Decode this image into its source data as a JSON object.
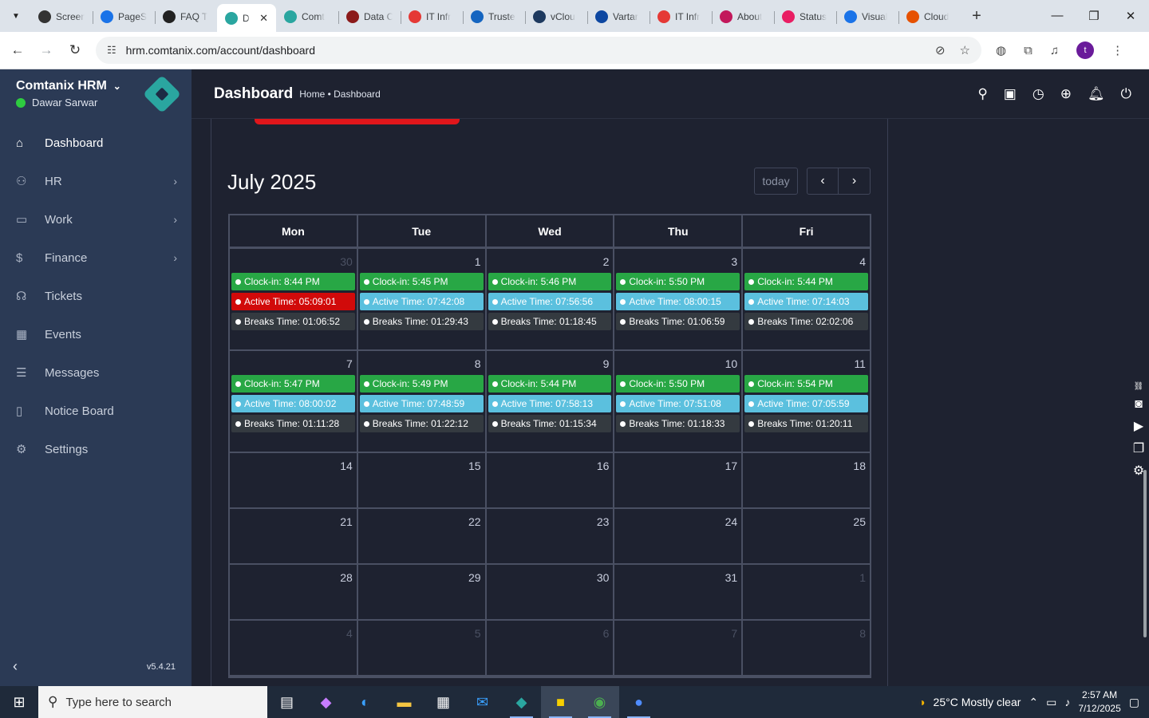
{
  "browser": {
    "tabs": [
      {
        "title": "Screen",
        "icon": "screen-icon",
        "color": "#333333"
      },
      {
        "title": "PageSpeed",
        "icon": "pagespeed-icon",
        "color": "#1a73e8"
      },
      {
        "title": "FAQ T",
        "icon": "faq-icon",
        "color": "#222222"
      },
      {
        "title": "D",
        "icon": "comtanix-icon",
        "color": "#2aa6a0",
        "active": true
      },
      {
        "title": "Comt",
        "icon": "comtanix-icon",
        "color": "#2aa6a0"
      },
      {
        "title": "Data C",
        "icon": "vmware-icon",
        "color": "#8b1a1a"
      },
      {
        "title": "IT Infr",
        "icon": "itinfra-icon",
        "color": "#e53935"
      },
      {
        "title": "Truste",
        "icon": "trust-icon",
        "color": "#1565c0"
      },
      {
        "title": "vClou",
        "icon": "vcloud-icon",
        "color": "#1e3a5f"
      },
      {
        "title": "Vartar",
        "icon": "vartar-icon",
        "color": "#0d47a1"
      },
      {
        "title": "IT Infr",
        "icon": "itinfra-icon",
        "color": "#e53935"
      },
      {
        "title": "About",
        "icon": "about-icon",
        "color": "#c2185b"
      },
      {
        "title": "Status",
        "icon": "status-icon",
        "color": "#e91e63"
      },
      {
        "title": "Visual",
        "icon": "visual-icon",
        "color": "#1a73e8"
      },
      {
        "title": "Cloud",
        "icon": "cloud-icon",
        "color": "#e65100"
      }
    ],
    "url": "hrm.comtanix.com/account/dashboard"
  },
  "sidebar": {
    "brand": "Comtanix HRM",
    "user": "Dawar Sarwar",
    "items": [
      {
        "label": "Dashboard",
        "icon": "home-icon",
        "glyph": "⌂",
        "active": true,
        "arrow": false
      },
      {
        "label": "HR",
        "icon": "users-icon",
        "glyph": "⚇",
        "active": false,
        "arrow": true
      },
      {
        "label": "Work",
        "icon": "briefcase-icon",
        "glyph": "▭",
        "active": false,
        "arrow": true
      },
      {
        "label": "Finance",
        "icon": "dollar-icon",
        "glyph": "$",
        "active": false,
        "arrow": true
      },
      {
        "label": "Tickets",
        "icon": "headset-icon",
        "glyph": "☊",
        "active": false,
        "arrow": false
      },
      {
        "label": "Events",
        "icon": "calendar-icon",
        "glyph": "▦",
        "active": false,
        "arrow": false
      },
      {
        "label": "Messages",
        "icon": "message-icon",
        "glyph": "☰",
        "active": false,
        "arrow": false
      },
      {
        "label": "Notice Board",
        "icon": "clipboard-icon",
        "glyph": "▯",
        "active": false,
        "arrow": false
      },
      {
        "label": "Settings",
        "icon": "gear-icon",
        "glyph": "⚙",
        "active": false,
        "arrow": false
      }
    ],
    "version": "v5.4.21"
  },
  "header": {
    "title": "Dashboard",
    "breadcrumb": "Home • Dashboard"
  },
  "calendar": {
    "title": "July 2025",
    "today_label": "today",
    "days": [
      "Mon",
      "Tue",
      "Wed",
      "Thu",
      "Fri"
    ],
    "weeks": [
      [
        {
          "day": "30",
          "muted": true,
          "events": [
            {
              "type": "clock",
              "text": "Clock-in: 8:44 PM"
            },
            {
              "type": "late",
              "text": "Active Time: 05:09:01"
            },
            {
              "type": "breaks",
              "text": "Breaks Time: 01:06:52"
            }
          ]
        },
        {
          "day": "1",
          "events": [
            {
              "type": "clock",
              "text": "Clock-in: 5:45 PM"
            },
            {
              "type": "active",
              "text": "Active Time: 07:42:08"
            },
            {
              "type": "breaks",
              "text": "Breaks Time: 01:29:43"
            }
          ]
        },
        {
          "day": "2",
          "events": [
            {
              "type": "clock",
              "text": "Clock-in: 5:46 PM"
            },
            {
              "type": "active",
              "text": "Active Time: 07:56:56"
            },
            {
              "type": "breaks",
              "text": "Breaks Time: 01:18:45"
            }
          ]
        },
        {
          "day": "3",
          "events": [
            {
              "type": "clock",
              "text": "Clock-in: 5:50 PM"
            },
            {
              "type": "active",
              "text": "Active Time: 08:00:15"
            },
            {
              "type": "breaks",
              "text": "Breaks Time: 01:06:59"
            }
          ]
        },
        {
          "day": "4",
          "events": [
            {
              "type": "clock",
              "text": "Clock-in: 5:44 PM"
            },
            {
              "type": "active",
              "text": "Active Time: 07:14:03"
            },
            {
              "type": "breaks",
              "text": "Breaks Time: 02:02:06"
            }
          ]
        }
      ],
      [
        {
          "day": "7",
          "events": [
            {
              "type": "clock",
              "text": "Clock-in: 5:47 PM"
            },
            {
              "type": "active",
              "text": "Active Time: 08:00:02"
            },
            {
              "type": "breaks",
              "text": "Breaks Time: 01:11:28"
            }
          ]
        },
        {
          "day": "8",
          "events": [
            {
              "type": "clock",
              "text": "Clock-in: 5:49 PM"
            },
            {
              "type": "active",
              "text": "Active Time: 07:48:59"
            },
            {
              "type": "breaks",
              "text": "Breaks Time: 01:22:12"
            }
          ]
        },
        {
          "day": "9",
          "events": [
            {
              "type": "clock",
              "text": "Clock-in: 5:44 PM"
            },
            {
              "type": "active",
              "text": "Active Time: 07:58:13"
            },
            {
              "type": "breaks",
              "text": "Breaks Time: 01:15:34"
            }
          ]
        },
        {
          "day": "10",
          "events": [
            {
              "type": "clock",
              "text": "Clock-in: 5:50 PM"
            },
            {
              "type": "active",
              "text": "Active Time: 07:51:08"
            },
            {
              "type": "breaks",
              "text": "Breaks Time: 01:18:33"
            }
          ]
        },
        {
          "day": "11",
          "events": [
            {
              "type": "clock",
              "text": "Clock-in: 5:54 PM"
            },
            {
              "type": "active",
              "text": "Active Time: 07:05:59"
            },
            {
              "type": "breaks",
              "text": "Breaks Time: 01:20:11"
            }
          ]
        }
      ],
      [
        {
          "day": "14",
          "events": []
        },
        {
          "day": "15",
          "events": []
        },
        {
          "day": "16",
          "events": []
        },
        {
          "day": "17",
          "events": []
        },
        {
          "day": "18",
          "events": []
        }
      ],
      [
        {
          "day": "21",
          "events": []
        },
        {
          "day": "22",
          "events": []
        },
        {
          "day": "23",
          "events": []
        },
        {
          "day": "24",
          "events": []
        },
        {
          "day": "25",
          "events": []
        }
      ],
      [
        {
          "day": "28",
          "events": []
        },
        {
          "day": "29",
          "events": []
        },
        {
          "day": "30",
          "events": []
        },
        {
          "day": "31",
          "events": []
        },
        {
          "day": "1",
          "muted": true,
          "events": []
        }
      ],
      [
        {
          "day": "4",
          "muted": true,
          "events": []
        },
        {
          "day": "5",
          "muted": true,
          "events": []
        },
        {
          "day": "6",
          "muted": true,
          "events": []
        },
        {
          "day": "7",
          "muted": true,
          "events": []
        },
        {
          "day": "8",
          "muted": true,
          "events": []
        }
      ]
    ]
  },
  "taskbar": {
    "search_placeholder": "Type here to search",
    "weather": "25°C  Mostly clear",
    "time": "2:57 AM",
    "date": "7/12/2025"
  },
  "colors": {
    "clock": "#28a745",
    "active": "#5bc0de",
    "late": "#d10a0a",
    "breaks": "#343a40",
    "sidebar": "#2b3a55"
  }
}
